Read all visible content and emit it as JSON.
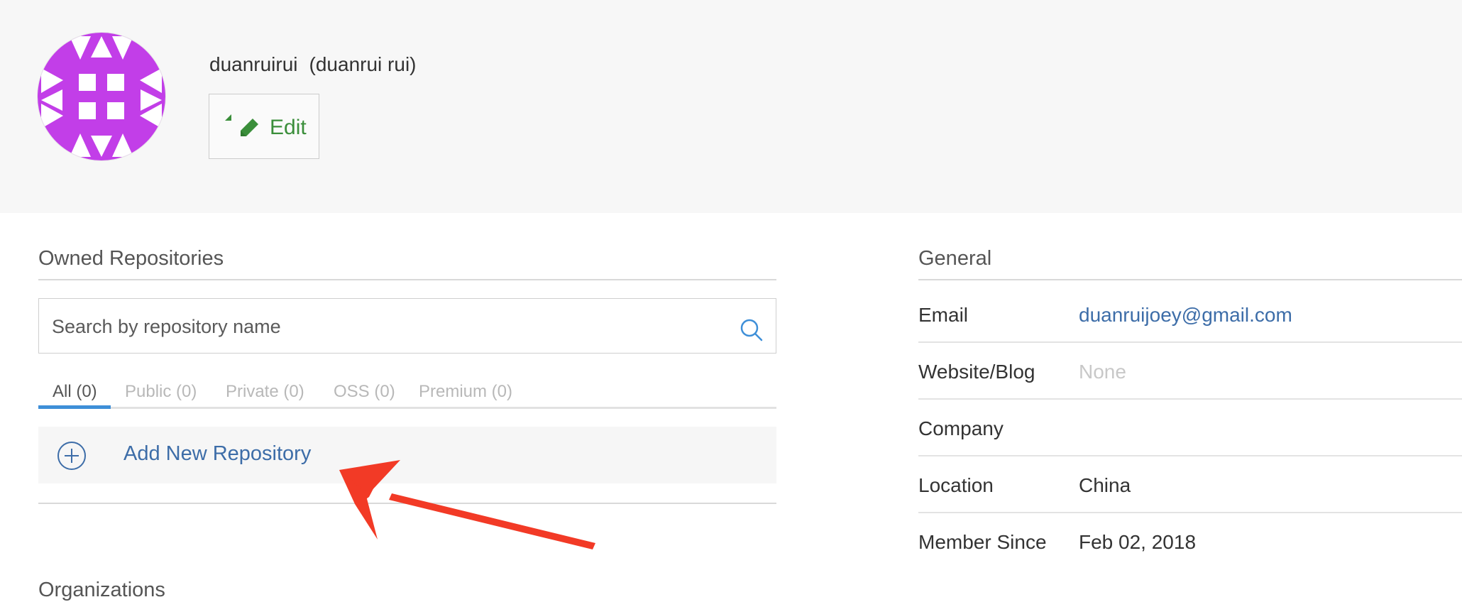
{
  "profile": {
    "username": "duanruirui",
    "fullname": "(duanrui rui)",
    "edit_label": "Edit",
    "avatar_color": "#c23ee8"
  },
  "repositories": {
    "title": "Owned Repositories",
    "search_placeholder": "Search by repository name",
    "tabs": [
      {
        "label": "All (0)",
        "active": true
      },
      {
        "label": "Public (0)",
        "active": false
      },
      {
        "label": "Private (0)",
        "active": false
      },
      {
        "label": "OSS (0)",
        "active": false
      },
      {
        "label": "Premium (0)",
        "active": false
      }
    ],
    "add_new_label": "Add New Repository"
  },
  "organizations": {
    "title": "Organizations"
  },
  "general": {
    "title": "General",
    "rows": [
      {
        "label": "Email",
        "value": "duanruijoey@gmail.com"
      },
      {
        "label": "Website/Blog",
        "value": "None"
      },
      {
        "label": "Company",
        "value": ""
      },
      {
        "label": "Location",
        "value": "China"
      },
      {
        "label": "Member Since",
        "value": "Feb 02, 2018"
      }
    ]
  },
  "colors": {
    "accent_blue": "#3e8fd8",
    "link": "#3d6da8",
    "edit_green": "#3a8e3a",
    "annotation_arrow": "#f23a26"
  }
}
